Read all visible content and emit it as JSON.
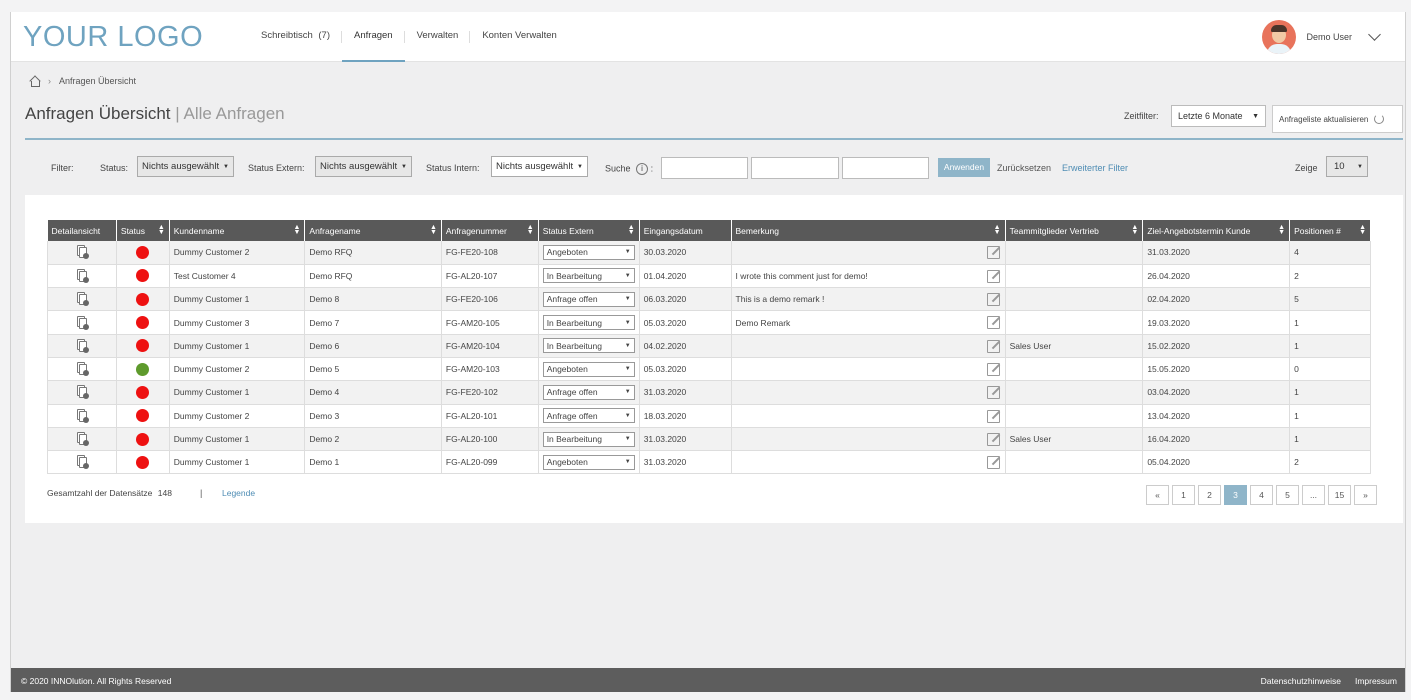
{
  "header": {
    "logo": "YOUR LOGO",
    "nav": [
      {
        "label": "Schreibtisch",
        "count": "(7)"
      },
      {
        "label": "Anfragen"
      },
      {
        "label": "Verwalten"
      },
      {
        "label": "Konten Verwalten"
      }
    ],
    "active_nav": "Anfragen",
    "user_name": "Demo User"
  },
  "breadcrumb": {
    "current": "Anfragen Übersicht"
  },
  "title": {
    "main": "Anfragen Übersicht",
    "separator": "|",
    "sub": "Alle Anfragen"
  },
  "zeitfilter": {
    "label": "Zeitfilter:",
    "value": "Letzte 6 Monate",
    "refresh_label": "Anfrageliste aktualisieren"
  },
  "filter": {
    "label": "Filter:",
    "status_label": "Status:",
    "status_value": "Nichts ausgewählt",
    "status_extern_label": "Status Extern:",
    "status_extern_value": "Nichts ausgewählt",
    "status_intern_label": "Status Intern:",
    "status_intern_value": "Nichts ausgewählt",
    "search_label": "Suche",
    "search_colon": ":",
    "search_values": [
      "",
      "",
      ""
    ],
    "apply_label": "Anwenden",
    "reset_label": "Zurücksetzen",
    "extended_label": "Erweiterter Filter",
    "show_label": "Zeige",
    "show_value": "10"
  },
  "table": {
    "columns": [
      "Detailansicht",
      "Status",
      "Kundenname",
      "Anfragename",
      "Anfragenummer",
      "Status Extern",
      "Eingangsdatum",
      "Bemerkung",
      "Teammitglieder Vertrieb",
      "Ziel-Angebotstermin Kunde",
      "Positionen #"
    ],
    "rows": [
      {
        "status_color": "#ee1111",
        "kunde": "Dummy Customer 2",
        "anfrage": "Demo RFQ",
        "nummer": "FG-FE20-108",
        "status_extern": "Angeboten",
        "datum": "30.03.2020",
        "bemerkung": "",
        "team": "",
        "ziel": "31.03.2020",
        "pos": "4"
      },
      {
        "status_color": "#ee1111",
        "kunde": "Test Customer 4",
        "anfrage": "Demo RFQ",
        "nummer": "FG-AL20-107",
        "status_extern": "In Bearbeitung",
        "datum": "01.04.2020",
        "bemerkung": "I wrote this comment just for demo!",
        "team": "",
        "ziel": "26.04.2020",
        "pos": "2"
      },
      {
        "status_color": "#ee1111",
        "kunde": "Dummy Customer 1",
        "anfrage": "Demo 8",
        "nummer": "FG-FE20-106",
        "status_extern": "Anfrage offen",
        "datum": "06.03.2020",
        "bemerkung": "This is a demo remark !",
        "team": "",
        "ziel": "02.04.2020",
        "pos": "5"
      },
      {
        "status_color": "#ee1111",
        "kunde": "Dummy Customer 3",
        "anfrage": "Demo 7",
        "nummer": "FG-AM20-105",
        "status_extern": "In Bearbeitung",
        "datum": "05.03.2020",
        "bemerkung": "Demo Remark",
        "team": "",
        "ziel": "19.03.2020",
        "pos": "1"
      },
      {
        "status_color": "#ee1111",
        "kunde": "Dummy Customer 1",
        "anfrage": "Demo 6",
        "nummer": "FG-AM20-104",
        "status_extern": "In Bearbeitung",
        "datum": "04.02.2020",
        "bemerkung": "",
        "team": "Sales User",
        "ziel": "15.02.2020",
        "pos": "1"
      },
      {
        "status_color": "#5e9a2c",
        "kunde": "Dummy Customer 2",
        "anfrage": "Demo 5",
        "nummer": "FG-AM20-103",
        "status_extern": "Angeboten",
        "datum": "05.03.2020",
        "bemerkung": "",
        "team": "",
        "ziel": "15.05.2020",
        "pos": "0"
      },
      {
        "status_color": "#ee1111",
        "kunde": "Dummy Customer 1",
        "anfrage": "Demo 4",
        "nummer": "FG-FE20-102",
        "status_extern": "Anfrage offen",
        "datum": "31.03.2020",
        "bemerkung": "",
        "team": "",
        "ziel": "03.04.2020",
        "pos": "1"
      },
      {
        "status_color": "#ee1111",
        "kunde": "Dummy Customer 2",
        "anfrage": "Demo 3",
        "nummer": "FG-AL20-101",
        "status_extern": "Anfrage offen",
        "datum": "18.03.2020",
        "bemerkung": "",
        "team": "",
        "ziel": "13.04.2020",
        "pos": "1"
      },
      {
        "status_color": "#ee1111",
        "kunde": "Dummy Customer 1",
        "anfrage": "Demo 2",
        "nummer": "FG-AL20-100",
        "status_extern": "In Bearbeitung",
        "datum": "31.03.2020",
        "bemerkung": "",
        "team": "Sales User",
        "ziel": "16.04.2020",
        "pos": "1"
      },
      {
        "status_color": "#ee1111",
        "kunde": "Dummy Customer 1",
        "anfrage": "Demo 1",
        "nummer": "FG-AL20-099",
        "status_extern": "Angeboten",
        "datum": "31.03.2020",
        "bemerkung": "",
        "team": "",
        "ziel": "05.04.2020",
        "pos": "2"
      }
    ]
  },
  "summary": {
    "total_label": "Gesamtzahl der Datensätze",
    "total_value": "148",
    "separator": "|",
    "legend_label": "Legende"
  },
  "pagination": {
    "items": [
      "«",
      "1",
      "2",
      "3",
      "4",
      "5",
      "...",
      "15",
      "»"
    ],
    "active": "3"
  },
  "footer": {
    "copyright": "© 2020 INNOlution. All Rights Reserved",
    "links": [
      "Datenschutzhinweise",
      "Impressum"
    ]
  },
  "icons": {
    "home": "home-icon",
    "info": "info-icon",
    "refresh": "refresh-icon",
    "document": "document-lock-icon",
    "edit": "edit-icon",
    "chevron": "chevron-down-icon"
  }
}
